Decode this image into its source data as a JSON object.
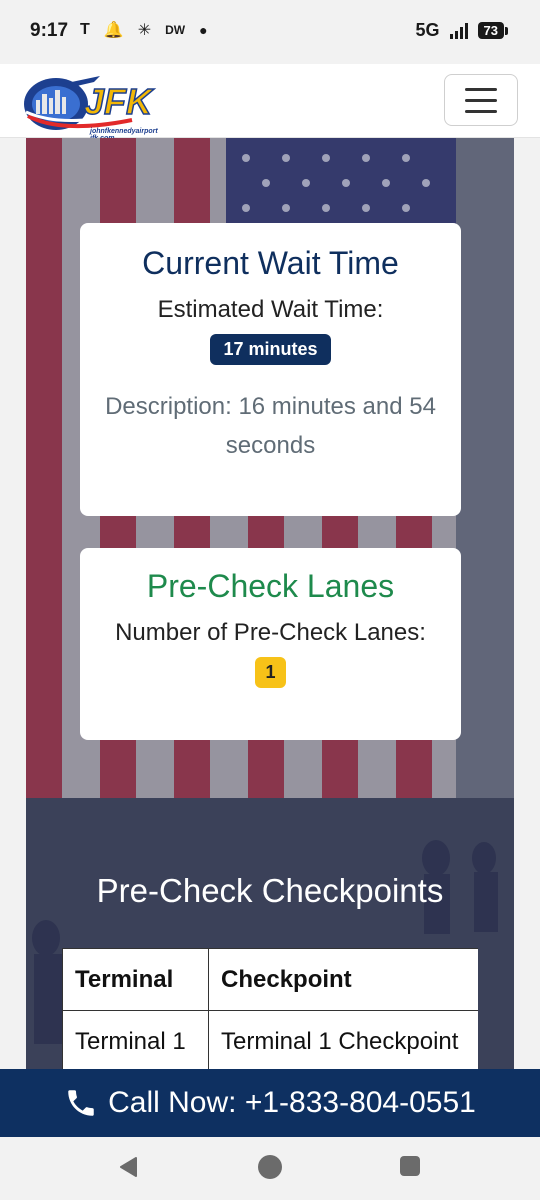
{
  "status_bar": {
    "time": "9:17",
    "carrier_icon": "T",
    "network": "5G",
    "battery": "73",
    "dw_label": "DW"
  },
  "header": {
    "logo_text": "JFK",
    "logo_caption": "johnfkennedyairport jfk.com",
    "menu_icon": "hamburger-icon"
  },
  "wait_card": {
    "title": "Current Wait Time",
    "label": "Estimated Wait Time:",
    "badge": "17 minutes",
    "description": "Description: 16 minutes and 54 seconds"
  },
  "precheck_card": {
    "title": "Pre-Check Lanes",
    "label": "Number of Pre-Check Lanes:",
    "badge": "1"
  },
  "checkpoints": {
    "title": "Pre-Check Checkpoints",
    "headers": [
      "Terminal",
      "Checkpoint"
    ],
    "rows": [
      [
        "Terminal 1",
        "Terminal 1 Checkpoint"
      ]
    ]
  },
  "call_bar": {
    "label": "Call Now: +1-833-804-0551",
    "icon": "phone-icon"
  },
  "colors": {
    "navy": "#0f2f5e",
    "green": "#1e8a4c",
    "yellow": "#f7c218",
    "call_bar": "#0e3061"
  }
}
